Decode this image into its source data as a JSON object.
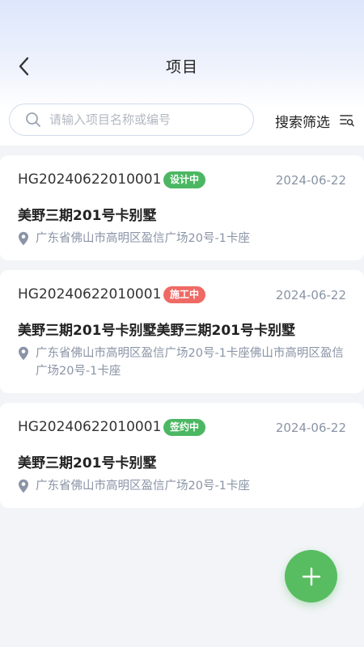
{
  "header": {
    "title": "项目"
  },
  "search": {
    "placeholder": "请输入项目名称或编号",
    "value": ""
  },
  "filter": {
    "label": "搜索筛选"
  },
  "projects": [
    {
      "code": "HG20240622010001",
      "status": "设计中",
      "status_color": "#4cb763",
      "date": "2024-06-22",
      "name": "美野三期201号卡别墅",
      "address": "广东省佛山市高明区盈信广场20号-1卡座"
    },
    {
      "code": "HG20240622010001",
      "status": "施工中",
      "status_color": "#ef6a65",
      "date": "2024-06-22",
      "name": "美野三期201号卡别墅美野三期201号卡别墅",
      "address": "广东省佛山市高明区盈信广场20号-1卡座佛山市高明区盈信广场20号-1卡座"
    },
    {
      "code": "HG20240622010001",
      "status": "签约中",
      "status_color": "#4cb763",
      "date": "2024-06-22",
      "name": "美野三期201号卡别墅",
      "address": "广东省佛山市高明区盈信广场20号-1卡座"
    }
  ],
  "icons": {
    "back": "chevron-left-icon",
    "search": "search-icon",
    "filter": "filter-list-icon",
    "location": "location-pin-icon",
    "add": "plus-icon"
  },
  "colors": {
    "accent_green": "#58bd61",
    "status_green": "#4cb763",
    "status_red": "#ef6a65"
  }
}
